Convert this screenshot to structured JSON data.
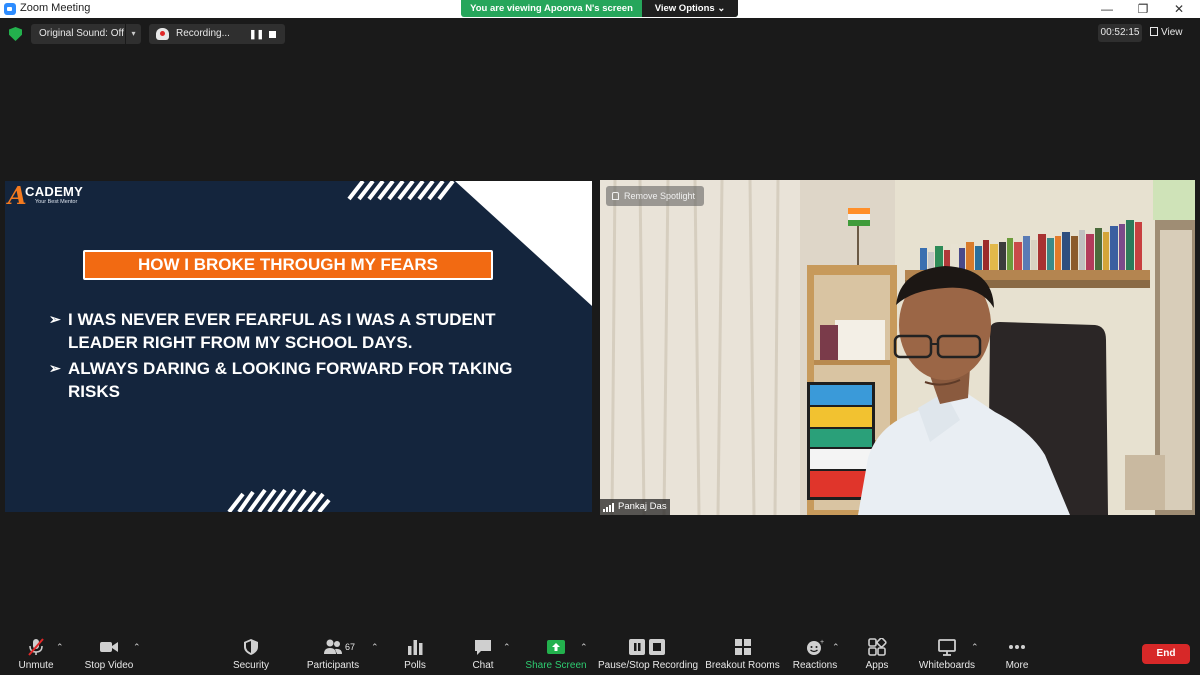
{
  "window": {
    "title": "Zoom Meeting"
  },
  "banner": {
    "message": "You are viewing Apoorva N's screen",
    "options_label": "View Options ⌄"
  },
  "window_controls": {
    "minimize": "—",
    "maximize": "❐",
    "close": "✕"
  },
  "top_toolbar": {
    "original_sound_label": "Original Sound: Off",
    "dropdown_arrow": "▾",
    "recording_label": "Recording...",
    "pause_glyph": "❚❚",
    "timer": "00:52:15",
    "view_label": "View"
  },
  "slide": {
    "logo_initial": "A",
    "logo_word": "CADEMY",
    "logo_tagline": "Your Best Mentor",
    "heading": "HOW I BROKE THROUGH MY FEARS",
    "bullet_glyph": "➢",
    "bullets": [
      "I WAS NEVER EVER FEARFUL AS I WAS A STUDENT LEADER RIGHT FROM MY SCHOOL DAYS.",
      "ALWAYS DARING & LOOKING FORWARD FOR TAKING RISKS"
    ]
  },
  "video": {
    "spotlight_label": "Remove Spotlight",
    "participant_name": "Pankaj Das",
    "poster_lines": [
      "ALWAYS",
      "LOOK ON",
      "THE bright",
      "SIDE OF",
      "LIFE"
    ]
  },
  "bottom_toolbar": {
    "unmute": "Unmute",
    "stop_video": "Stop Video",
    "security": "Security",
    "participants": "Participants",
    "participants_count": "67",
    "polls": "Polls",
    "chat": "Chat",
    "share_screen": "Share Screen",
    "pause_stop_recording": "Pause/Stop Recording",
    "breakout_rooms": "Breakout Rooms",
    "reactions": "Reactions",
    "apps": "Apps",
    "whiteboards": "Whiteboards",
    "more": "More",
    "end": "End",
    "caret": "⌃"
  },
  "colors": {
    "zoom_blue": "#2d8cff",
    "viewing_green": "#26a65b",
    "end_red": "#d72828",
    "slide_navy": "#14253d",
    "heading_orange": "#f26a12"
  }
}
